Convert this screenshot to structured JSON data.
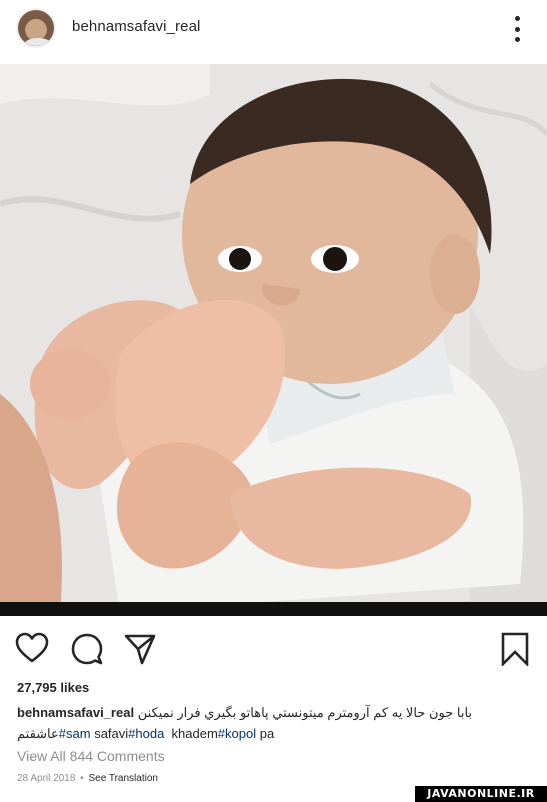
{
  "header": {
    "username": "behnamsafavi_real",
    "more_icon": "more-vertical-icon"
  },
  "post": {
    "photo_label": "baby biting foot photo",
    "likes": "27,795 likes",
    "caption_user": "behnamsafavi_real",
    "caption_text": "بابا جون حالا یه کم آرومترم میتونستي پاهاتو بگیري فرار نمیکنن",
    "tags": {
      "t1_prefix": "عاشقتم",
      "t1": "#sam",
      "t2_text": "safavi",
      "t2": "#hoda",
      "t3_text": "khadem",
      "t3": "#kopol",
      "t4_text": "pa"
    },
    "view_comments": "View All 844 Comments",
    "date": "28 April 2018",
    "separator": "•",
    "translation": "See Translation"
  },
  "actions": {
    "like_icon": "heart-icon",
    "comment_icon": "comment-icon",
    "share_icon": "send-icon",
    "save_icon": "bookmark-icon"
  },
  "watermark": "JAVANONLINE.IR"
}
